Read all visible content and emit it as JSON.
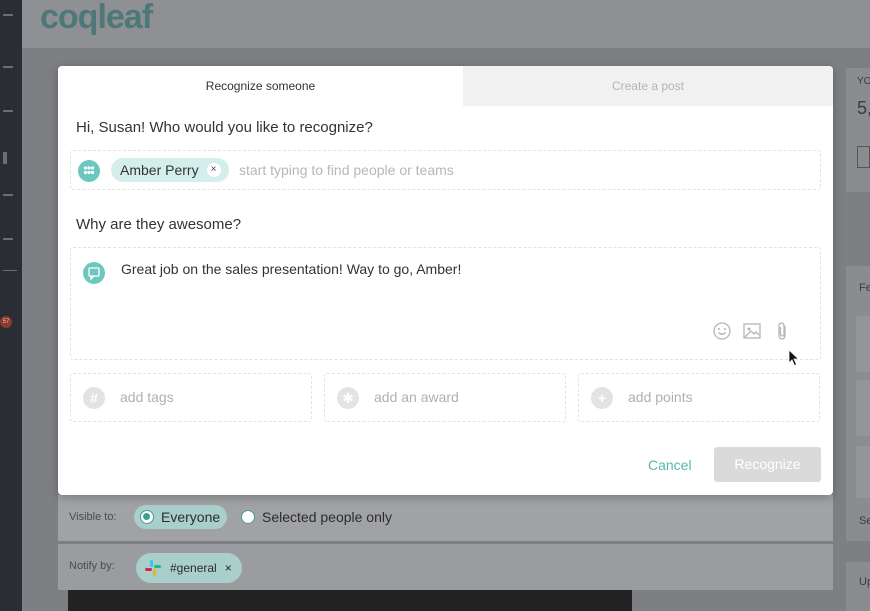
{
  "app": {
    "logo_text": "coqleaf"
  },
  "background": {
    "sidebar_badge": "57",
    "right_card_title": "YO",
    "right_card_value": "5,",
    "right_panel_label_1": "Fe",
    "right_panel_label_2": "Se",
    "right_panel_label_3": "Up"
  },
  "tabs": [
    {
      "label": "Recognize someone",
      "active": true
    },
    {
      "label": "Create a post",
      "active": false
    }
  ],
  "recipient": {
    "prompt": "Hi, Susan! Who would you like to recognize?",
    "selected": "Amber Perry",
    "remove_glyph": "×",
    "placeholder": "start typing to find people or teams"
  },
  "message": {
    "prompt": "Why are they awesome?",
    "text": "Great job on the sales presentation! Way to go, Amber!",
    "tools": [
      "emoji-icon",
      "image-icon",
      "paperclip-icon"
    ]
  },
  "extras": [
    {
      "glyph": "#",
      "label": "add tags",
      "icon": "hashtag-icon"
    },
    {
      "glyph": "✱",
      "label": "add an award",
      "icon": "award-icon"
    },
    {
      "glyph": "+",
      "label": "add points",
      "icon": "plus-icon"
    }
  ],
  "actions": {
    "cancel": "Cancel",
    "recognize": "Recognize"
  },
  "visibility": {
    "label": "Visible to:",
    "options": [
      {
        "label": "Everyone",
        "selected": true
      },
      {
        "label": "Selected people only",
        "selected": false
      }
    ]
  },
  "notify": {
    "label": "Notify by:",
    "channel": "#general",
    "remove_glyph": "×"
  },
  "colors": {
    "accent": "#56b8ad",
    "chip": "#d4efeb",
    "disabled_button": "#dadada"
  }
}
